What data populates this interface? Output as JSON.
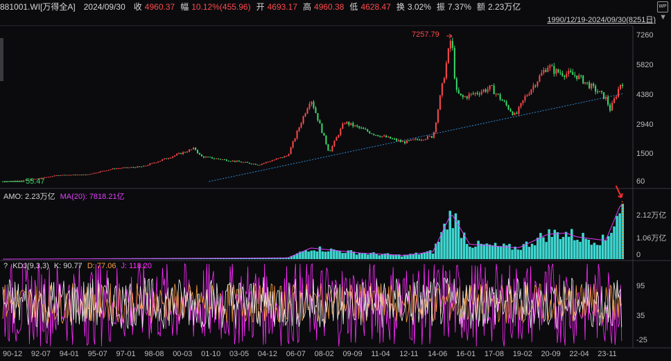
{
  "header": {
    "code": "881001.WI[万得全A]",
    "date": "2024/09/30",
    "close_label": "收",
    "close_value": "4960.37",
    "change_label": "幅",
    "change_value": "10.12%(455.96)",
    "open_label": "开",
    "open_value": "4693.17",
    "high_label": "高",
    "high_value": "4960.38",
    "low_label": "低",
    "low_value": "4628.47",
    "turnover_label": "换",
    "turnover_value": "3.02%",
    "amplitude_label": "振",
    "amplitude_value": "7.37%",
    "amount_label": "额",
    "amount_value": "2.23万亿",
    "range": "1990/12/19-2024/09/30(8251日)",
    "wp_icon": "WP"
  },
  "price_panel": {
    "max_label": "7257.79",
    "min_label": "55.47",
    "y_ticks": [
      "7260",
      "5820",
      "4380",
      "2940",
      "1500",
      "60"
    ]
  },
  "volume_panel": {
    "label": "AMO: 2.23万亿",
    "ma_label": "MA(20): 7818.21亿",
    "y_ticks": [
      "2.12万亿",
      "1.06万亿",
      "0"
    ]
  },
  "kdj_panel": {
    "question": "?",
    "name": "KDJ(9,3,3)",
    "k_label": "K: 90.77",
    "d_label": "D: 77.06",
    "j_label": "J: 118.20",
    "y_ticks": [
      "95",
      "35",
      "-25"
    ]
  },
  "x_ticks": [
    "90-12",
    "92-07",
    "94-01",
    "95-07",
    "97-01",
    "98-08",
    "00-03",
    "01-10",
    "03-05",
    "04-12",
    "06-07",
    "08-02",
    "09-09",
    "11-04",
    "12-11",
    "14-06",
    "16-01",
    "17-08",
    "19-02",
    "20-09",
    "22-04",
    "23-11"
  ],
  "colors": {
    "up": "#ff4a4a",
    "down": "#3bdc6a",
    "volume": "#3fd6d0",
    "ma": "#e040fb",
    "trend": "#2f8fd8",
    "kdj": "#ff2bff"
  },
  "chart_data": [
    {
      "type": "line",
      "title": "881001.WI[万得全A]",
      "x": [
        "1990-12",
        "1992-07",
        "1994-01",
        "1995-07",
        "1997-01",
        "1998-08",
        "2000-03",
        "2001-06",
        "2001-10",
        "2003-05",
        "2004-12",
        "2006-07",
        "2007-10",
        "2008-10",
        "2009-08",
        "2010-06",
        "2011-04",
        "2012-11",
        "2014-06",
        "2015-06",
        "2015-09",
        "2016-01",
        "2017-08",
        "2018-12",
        "2019-06",
        "2020-09",
        "2021-02",
        "2022-04",
        "2023-11",
        "2024-02",
        "2024-09"
      ],
      "y": [
        60,
        150,
        380,
        400,
        700,
        800,
        1300,
        1700,
        1300,
        1100,
        900,
        1350,
        4200,
        1500,
        3000,
        2700,
        2400,
        2000,
        2300,
        7257.79,
        4500,
        4200,
        4700,
        3300,
        4200,
        5800,
        5500,
        5300,
        4200,
        3600,
        4960.37
      ],
      "ylim": [
        60,
        7260
      ],
      "max_point": 7257.79,
      "min_point": 55.47
    },
    {
      "type": "bar",
      "title": "AMO",
      "series": [
        {
          "name": "AMO",
          "x": [
            "1990-12",
            "2006-07",
            "2007-10",
            "2010-06",
            "2012-11",
            "2014-06",
            "2015-06",
            "2016-06",
            "2019-02",
            "2020-09",
            "2021-09",
            "2022-04",
            "2023-11",
            "2024-09"
          ],
          "values": [
            0,
            0.05,
            0.45,
            0.25,
            0.15,
            0.3,
            1.85,
            0.6,
            0.45,
            1.0,
            1.05,
            0.9,
            0.75,
            2.23
          ]
        }
      ],
      "unit": "万亿",
      "ylim": [
        0,
        2.12
      ]
    },
    {
      "type": "line",
      "title": "KDJ(9,3,3)",
      "series": [
        {
          "name": "K",
          "last": 90.77
        },
        {
          "name": "D",
          "last": 77.06
        },
        {
          "name": "J",
          "last": 118.2
        }
      ],
      "ylim": [
        -25,
        95
      ]
    }
  ]
}
